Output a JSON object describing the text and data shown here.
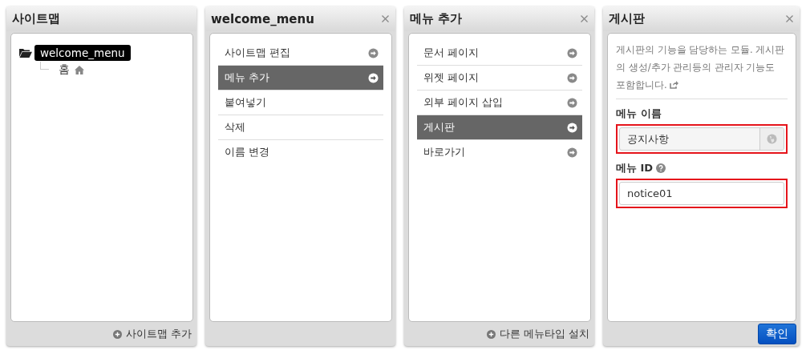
{
  "panels": [
    {
      "kind": "tree",
      "title": "사이트맵",
      "closable": false,
      "tree": [
        {
          "label": "welcome_menu",
          "selected": true,
          "children": [
            {
              "label": "홈",
              "home": true,
              "selected": false
            }
          ]
        }
      ],
      "footer_action": "사이트맵 추가"
    },
    {
      "kind": "menu",
      "title": "welcome_menu",
      "closable": true,
      "items": [
        {
          "label": "사이트맵 편집",
          "kind": "submenu",
          "selected": false
        },
        {
          "label": "메뉴 추가",
          "kind": "submenu",
          "selected": true
        },
        {
          "label": "붙여넣기",
          "kind": "action",
          "selected": false
        },
        {
          "label": "삭제",
          "kind": "action",
          "selected": false
        },
        {
          "label": "이름 변경",
          "kind": "action",
          "selected": false
        }
      ]
    },
    {
      "kind": "menu",
      "title": "메뉴 추가",
      "closable": true,
      "items": [
        {
          "label": "문서 페이지",
          "kind": "submenu",
          "selected": false
        },
        {
          "label": "위젯 페이지",
          "kind": "submenu",
          "selected": false
        },
        {
          "label": "외부 페이지 삽입",
          "kind": "submenu",
          "selected": false
        },
        {
          "label": "게시판",
          "kind": "submenu",
          "selected": true
        },
        {
          "label": "바로가기",
          "kind": "submenu",
          "selected": false
        }
      ],
      "footer_action": "다른 메뉴타입 설치"
    },
    {
      "kind": "form",
      "title": "게시판",
      "closable": true,
      "description": "게시판의 기능을 담당하는 모듈. 게시판의 생성/추가 관리등의 관리자 기능도 포함합니다.",
      "fields": [
        {
          "label": "메뉴 이름",
          "value": "공지사항",
          "kind": "multilang",
          "highlighted": true
        },
        {
          "label": "메뉴 ID",
          "value": "notice01",
          "kind": "help",
          "highlighted": true
        }
      ],
      "submit": "확인"
    }
  ]
}
